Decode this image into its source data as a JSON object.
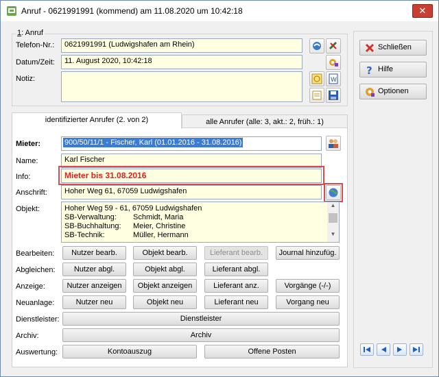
{
  "window": {
    "title": "Anruf - 0621991991 (kommend) am 11.08.2020 um 10:42:18",
    "close_glyph": "✕"
  },
  "anruf": {
    "group_label_key": "1",
    "group_label_rest": ": Anruf",
    "telefon_label": "Telefon-Nr.:",
    "telefon_value": "0621991991  (Ludwigshafen am Rhein)",
    "datum_label": "Datum/Zeit:",
    "datum_value": "11. August 2020,  10:42:18",
    "notiz_label": "Notiz:",
    "notiz_value": ""
  },
  "tabs": [
    {
      "label": "identifizierter Anrufer  (2. von 2)"
    },
    {
      "label": "alle Anrufer (alle: 3,  akt.: 2,  früh.: 1)"
    }
  ],
  "caller": {
    "mieter_label": "Mieter:",
    "mieter_value": "900/50/11/1 - Fischer, Karl  (01.01.2016 - 31.08.2016)",
    "name_label": "Name:",
    "name_value": "Karl Fischer",
    "info_label": "Info:",
    "info_value": "Mieter bis 31.08.2016",
    "anschrift_label": "Anschrift:",
    "anschrift_value": "Hoher Weg 61, 67059 Ludwigshafen",
    "objekt_label": "Objekt:",
    "objekt_address": "Hoher Weg 59 - 61, 67059 Ludwigshafen",
    "objekt_rows": [
      {
        "role": "SB-Verwaltung:",
        "person": "Schmidt, Maria"
      },
      {
        "role": "SB-Buchhaltung:",
        "person": "Meier, Christine"
      },
      {
        "role": "SB-Technik:",
        "person": "Müller, Hermann"
      }
    ]
  },
  "actions": {
    "bearbeiten": {
      "label": "Bearbeiten:",
      "buttons": [
        "Nutzer bearb.",
        "Objekt bearb.",
        "Lieferant bearb.",
        "Journal hinzufüg."
      ]
    },
    "abgleichen": {
      "label": "Abgleichen:",
      "buttons": [
        "Nutzer abgl.",
        "Objekt abgl.",
        "Lieferant abgl."
      ]
    },
    "anzeige": {
      "label": "Anzeige:",
      "buttons": [
        "Nutzer anzeigen",
        "Objekt anzeigen",
        "Lieferant anz.",
        "Vorgänge (-/-)"
      ]
    },
    "neuanlage": {
      "label": "Neuanlage:",
      "buttons": [
        "Nutzer neu",
        "Objekt neu",
        "Lieferant neu",
        "Vorgang neu"
      ]
    },
    "dienstleister": {
      "label": "Dienstleister:",
      "button": "Dienstleister"
    },
    "archiv": {
      "label": "Archiv:",
      "button": "Archiv"
    },
    "auswertung": {
      "label": "Auswertung:",
      "buttons": [
        "Kontoauszug",
        "Offene Posten"
      ]
    }
  },
  "sidebar": {
    "close_label": "Schließen",
    "help_label": "Hilfe",
    "options_label": "Optionen"
  },
  "colors": {
    "field_bg": "#ffffe1",
    "selection": "#3a7bd5",
    "info_red": "#e02020",
    "highlight_border": "#e3474b"
  }
}
